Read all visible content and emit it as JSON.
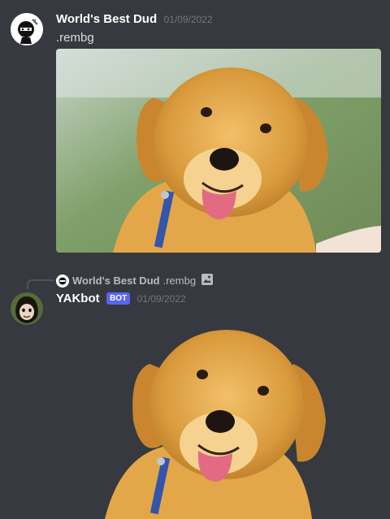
{
  "message1": {
    "username": "World's Best Dud",
    "timestamp": "01/09/2022",
    "content": ".rembg",
    "avatar_icon": "ninja-avatar-icon",
    "attachment": "puppy-photo"
  },
  "message2": {
    "reply": {
      "username": "World's Best Dud",
      "content": ".rembg",
      "attachment_icon": "image-icon"
    },
    "username": "YAKbot",
    "badge": "BOT",
    "timestamp": "01/09/2022",
    "avatar_icon": "yak-avatar-icon",
    "attachment": "puppy-background-removed"
  },
  "colors": {
    "background": "#36393f",
    "username": "#ffffff",
    "timestamp": "#72767d",
    "bot_badge": "#5865f2"
  }
}
